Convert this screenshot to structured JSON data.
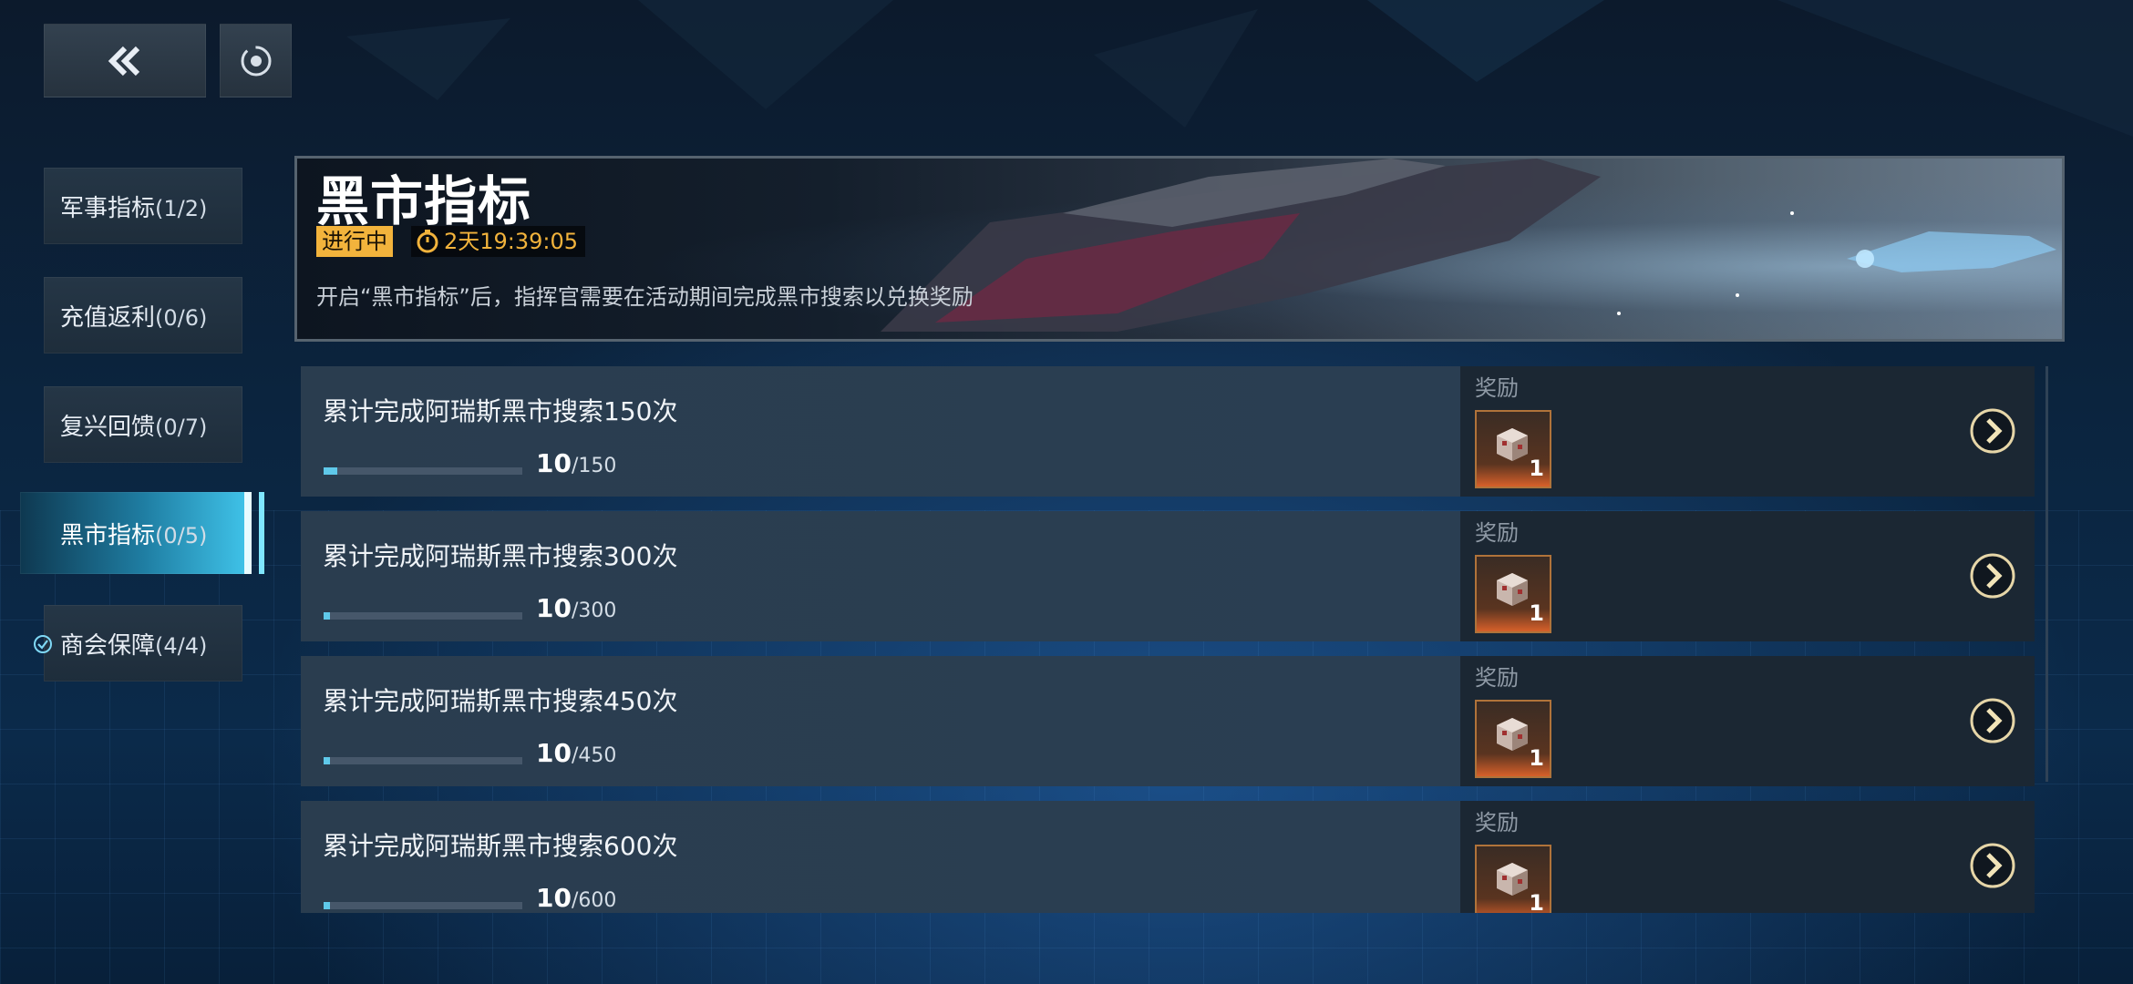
{
  "sidebar": {
    "items": [
      {
        "label": "军事指标",
        "count": "(1/2)",
        "active": false
      },
      {
        "label": "充值返利",
        "count": "(0/6)",
        "active": false
      },
      {
        "label": "复兴回馈",
        "count": "(0/7)",
        "active": false
      },
      {
        "label": "黑市指标",
        "count": "(0/5)",
        "active": true
      },
      {
        "label": "商会保障",
        "count": "(4/4)",
        "active": false,
        "completed": true
      }
    ]
  },
  "banner": {
    "title": "黑市指标",
    "status": "进行中",
    "timer": "2天19:39:05",
    "description": "开启“黑市指标”后，指挥官需要在活动期间完成黑市搜索以兑换奖励"
  },
  "tasks": [
    {
      "title": "累计完成阿瑞斯黑市搜索150次",
      "current": "10",
      "total": "/150",
      "progress": 0.0667,
      "reward_label": "奖励",
      "reward_qty": "1"
    },
    {
      "title": "累计完成阿瑞斯黑市搜索300次",
      "current": "10",
      "total": "/300",
      "progress": 0.0333,
      "reward_label": "奖励",
      "reward_qty": "1"
    },
    {
      "title": "累计完成阿瑞斯黑市搜索450次",
      "current": "10",
      "total": "/450",
      "progress": 0.0222,
      "reward_label": "奖励",
      "reward_qty": "1"
    },
    {
      "title": "累计完成阿瑞斯黑市搜索600次",
      "current": "10",
      "total": "/600",
      "progress": 0.0167,
      "reward_label": "奖励",
      "reward_qty": "1"
    }
  ],
  "icons": {
    "back": "double-chevron-left-icon",
    "refresh": "refresh-icon",
    "timer": "stopwatch-icon",
    "reward": "supply-box-icon",
    "go": "chevron-right-circle-icon",
    "completed": "check-circle-icon"
  },
  "colors": {
    "accent": "#3fc2e8",
    "status_bg": "#f2b33c",
    "progress_fill": "#5fc9ea",
    "reward_border": "#b0733a"
  }
}
